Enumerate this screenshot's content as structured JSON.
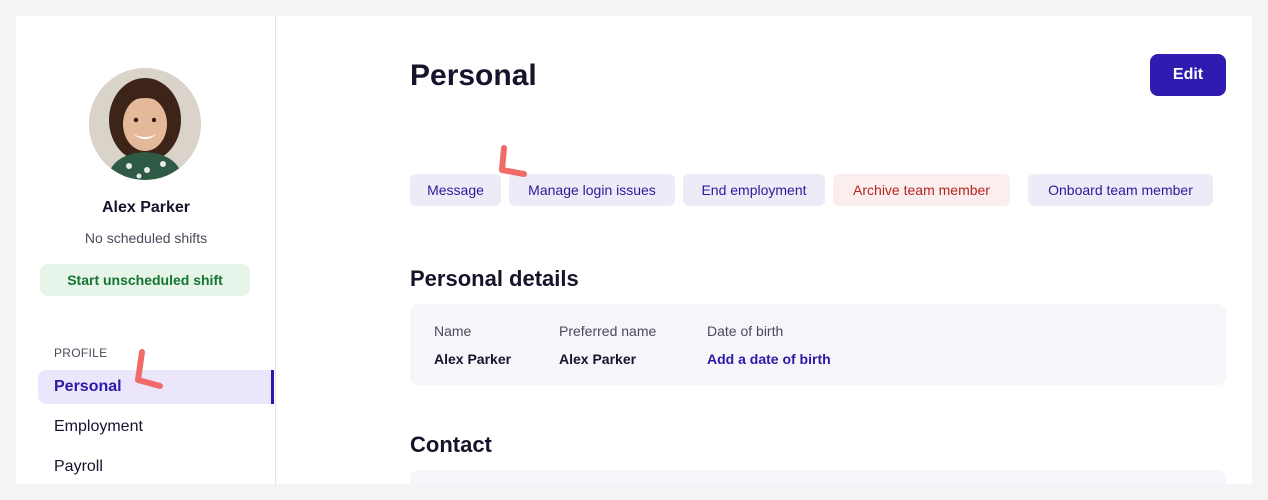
{
  "sidebar": {
    "user_name": "Alex Parker",
    "user_status": "No scheduled shifts",
    "start_shift_label": "Start unscheduled shift",
    "section_label": "PROFILE",
    "nav": [
      "Personal",
      "Employment",
      "Payroll"
    ],
    "active_nav": "Personal"
  },
  "main": {
    "title": "Personal",
    "edit_label": "Edit",
    "actions": [
      "Message",
      "Manage login issues",
      "End employment",
      "Archive team member",
      "Onboard team member"
    ],
    "personal_details": {
      "heading": "Personal details",
      "fields": [
        {
          "label": "Name",
          "value": "Alex Parker"
        },
        {
          "label": "Preferred name",
          "value": "Alex Parker"
        },
        {
          "label": "Date of birth",
          "value": "Add a date of birth"
        }
      ]
    },
    "contact": {
      "heading": "Contact"
    }
  },
  "colors": {
    "accent": "#2f1bb0",
    "accent_soft": "#ebe6fb",
    "success_bg": "#e6f4ea",
    "success_text": "#14752e",
    "danger_bg": "#fbeeee",
    "danger_text": "#b3261e",
    "annotation": "#f26b6b"
  },
  "icons": {
    "annotation_marks": [
      "annotation-check-mark",
      "annotation-check-mark"
    ]
  }
}
